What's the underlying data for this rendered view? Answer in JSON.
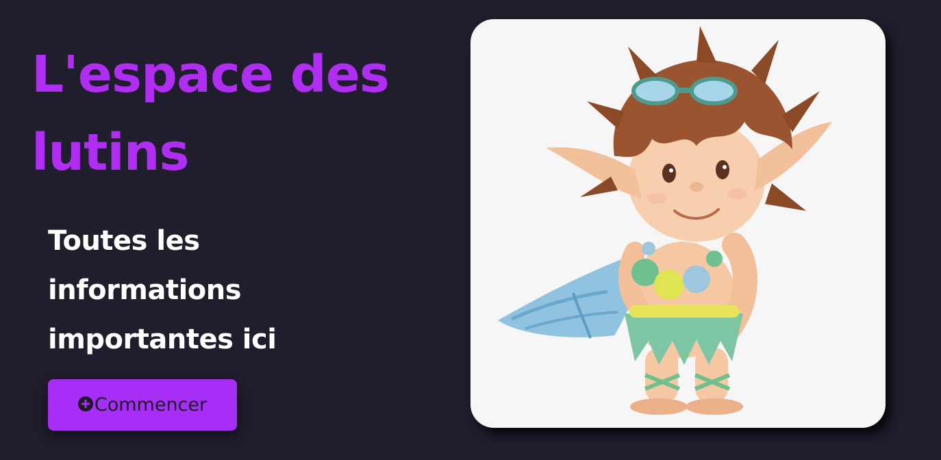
{
  "hero": {
    "title": "L'espace des lutins",
    "subtitle": "Toutes les informations importantes ici",
    "cta_label": "Commencer",
    "cta_icon": "plus-circle-icon"
  },
  "illustration": {
    "subject": "elf-character"
  },
  "colors": {
    "background": "#201d2c",
    "accent": "#b02ef2",
    "button": "#a72ef7",
    "card": "#f6f6f6"
  }
}
